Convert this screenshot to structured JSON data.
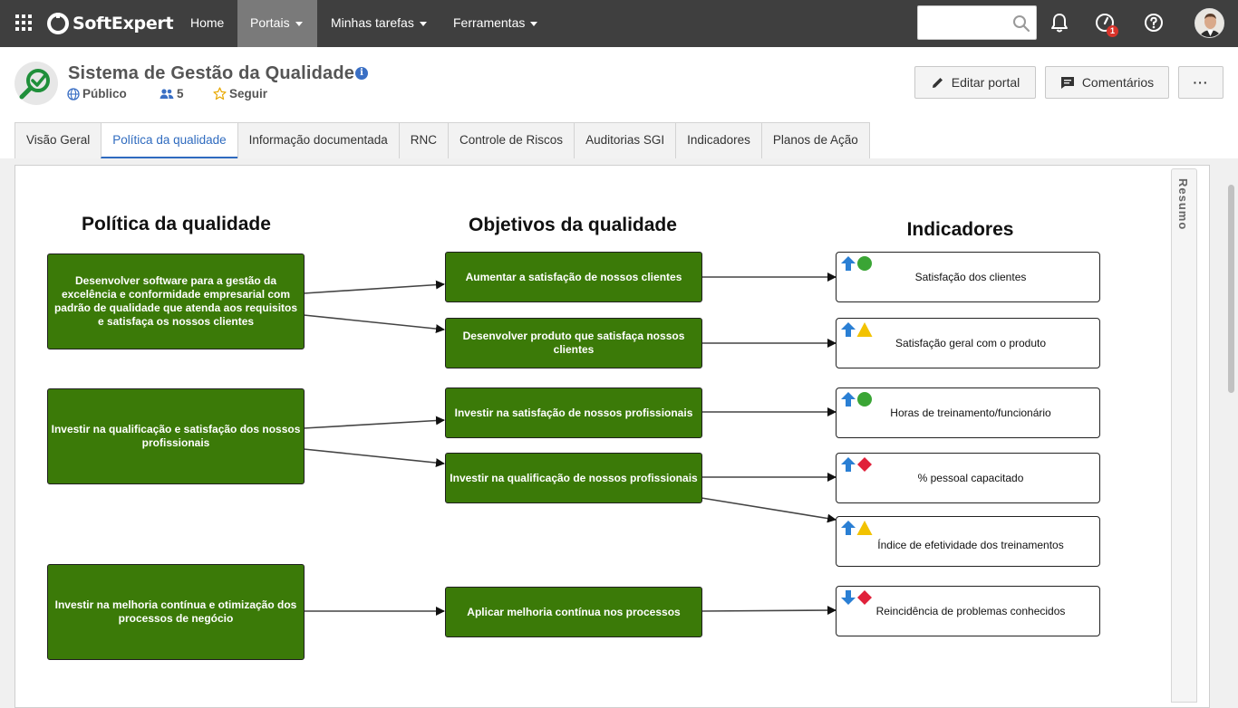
{
  "topnav": {
    "brand": "SoftExpert",
    "items": [
      {
        "label": "Home"
      },
      {
        "label": "Portais"
      },
      {
        "label": "Minhas tarefas"
      },
      {
        "label": "Ferramentas"
      }
    ],
    "search_value": "",
    "notification_badge": "1",
    "icons": [
      "apps-grid-icon",
      "search-icon",
      "bell-icon",
      "tasks-gauge-icon",
      "help-icon"
    ]
  },
  "header": {
    "title": "Sistema de Gestão da Qualidade",
    "visibility": "Público",
    "members": "5",
    "follow": "Seguir",
    "edit_button": "Editar portal",
    "comments_button": "Comentários",
    "more_button": "···"
  },
  "tabs": [
    {
      "label": "Visão Geral"
    },
    {
      "label": "Política da qualidade"
    },
    {
      "label": "Informação documentada"
    },
    {
      "label": "RNC"
    },
    {
      "label": "Controle de Riscos"
    },
    {
      "label": "Auditorias SGI"
    },
    {
      "label": "Indicadores"
    },
    {
      "label": "Planos de Ação"
    }
  ],
  "side_panel": {
    "label": "Resumo"
  },
  "diagram": {
    "headings": {
      "policy": "Política da qualidade",
      "objectives": "Objetivos da qualidade",
      "indicators": "Indicadores"
    },
    "policies": [
      "Desenvolver software para a gestão da excelência e conformidade empresarial com padrão de qualidade que atenda aos requisitos e satisfaça os nossos clientes",
      "Investir na qualificação e satisfação dos nossos profissionais",
      "Investir na melhoria contínua e otimização dos processos de negócio"
    ],
    "objectives": [
      "Aumentar a satisfação de nossos clientes",
      "Desenvolver produto que satisfaça nossos clientes",
      "Investir na satisfação de nossos profissionais",
      "Investir na qualificação de nossos profissionais",
      "Aplicar melhoria contínua nos processos"
    ],
    "indicators": [
      {
        "label": "Satisfação dos clientes",
        "trend": "up",
        "status": "green-circle"
      },
      {
        "label": "Satisfação geral com o produto",
        "trend": "up",
        "status": "yellow-triangle"
      },
      {
        "label": "Horas de treinamento/funcionário",
        "trend": "up",
        "status": "green-circle"
      },
      {
        "label": "% pessoal capacitado",
        "trend": "up",
        "status": "red-diamond"
      },
      {
        "label": "Índice de efetividade dos treinamentos",
        "trend": "up",
        "status": "yellow-triangle"
      },
      {
        "label": "Reincidência de problemas conhecidos",
        "trend": "down",
        "status": "red-diamond"
      }
    ],
    "colors": {
      "green_box": "#3b7a08",
      "arrow_up": "#2a7fd4",
      "status_green": "#3aa535",
      "status_yellow": "#f2c200",
      "status_red": "#e0213a"
    }
  }
}
